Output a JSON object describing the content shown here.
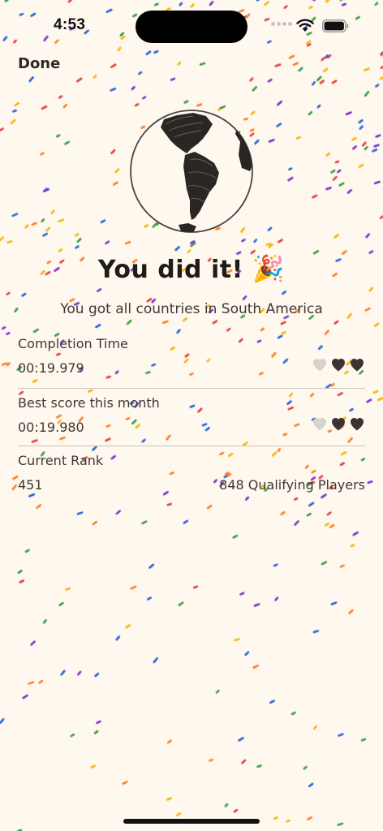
{
  "status_bar": {
    "time": "4:53"
  },
  "header": {
    "done_label": "Done"
  },
  "hero": {
    "icon": "globe-americas-icon",
    "headline": "You did it!",
    "headline_emoji": "🎉",
    "subtitle": "You got all countries in South America"
  },
  "stats": {
    "completion_time": {
      "label": "Completion Time",
      "value": "00:19.979",
      "hearts": {
        "filled": 2,
        "total": 3
      }
    },
    "best_score": {
      "label": "Best score this month",
      "value": "00:19.980",
      "hearts": {
        "filled": 2,
        "total": 3
      }
    },
    "current_rank": {
      "label": "Current Rank",
      "value": "451",
      "qualifying_players": "848 Qualifying Players"
    }
  },
  "colors": {
    "background": "#FFF8EF",
    "text": "#3d3833",
    "heart_filled": "#3a3330",
    "heart_empty": "#d6d2cc",
    "confetti": [
      "#e53935",
      "#1e5fd6",
      "#2e9d3a",
      "#f5b400",
      "#ff7a1a",
      "#7b2cc9"
    ]
  }
}
